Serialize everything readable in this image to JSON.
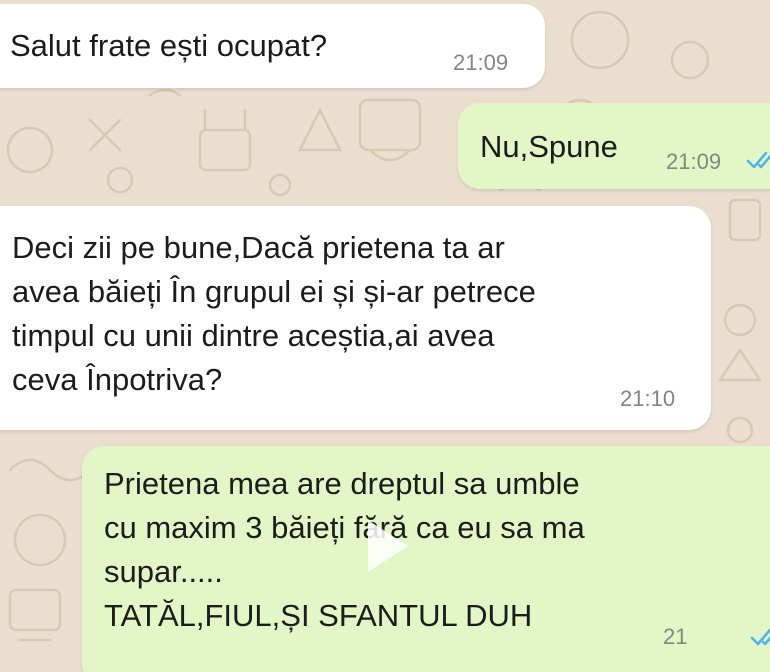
{
  "chat": {
    "wallpaper_color": "#eadfcf",
    "incoming_color": "#ffffff",
    "outgoing_color": "#e3f7c6",
    "tick_color": "#4fb6ec",
    "messages": [
      {
        "direction": "incoming",
        "text": "Salut frate ești ocupat?",
        "time": "21:09"
      },
      {
        "direction": "outgoing",
        "text": "Nu,Spune",
        "time": "21:09",
        "status_icon": "double-check-icon"
      },
      {
        "direction": "incoming",
        "text": "Deci zii pe bune,Dacă prietena ta ar\navea băieți În grupul ei și și-ar petrece\ntimpul cu unii dintre aceștia,ai avea\nceva Înpotriva?",
        "time": "21:10"
      },
      {
        "direction": "outgoing",
        "text": "Prietena mea are dreptul sa umble\ncu maxim 3 băieți fără ca eu sa ma\nsupar.....\nTATĂL,FIUL,ȘI SFANTUL DUH",
        "time": "21",
        "status_icon": "double-check-icon"
      }
    ]
  }
}
